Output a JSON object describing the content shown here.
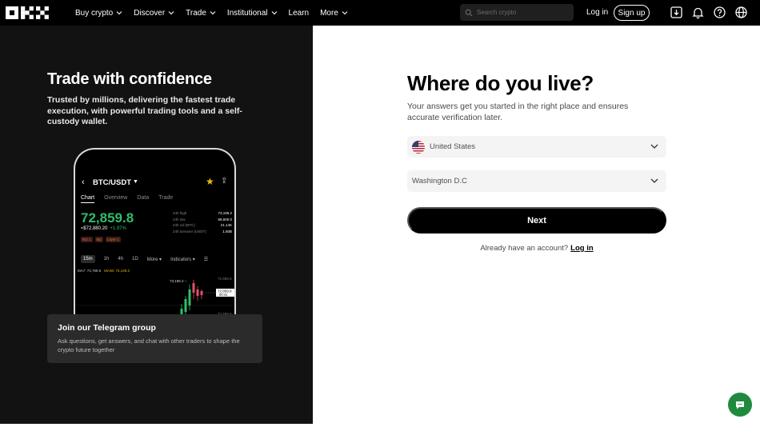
{
  "nav": {
    "logo": "OKX",
    "items": [
      {
        "label": "Buy crypto",
        "has_chevron": true
      },
      {
        "label": "Discover",
        "has_chevron": true
      },
      {
        "label": "Trade",
        "has_chevron": true
      },
      {
        "label": "Institutional",
        "has_chevron": true
      },
      {
        "label": "Learn",
        "has_chevron": false
      },
      {
        "label": "More",
        "has_chevron": true
      }
    ],
    "search_placeholder": "Search crypto",
    "login_label": "Log in",
    "signup_label": "Sign up",
    "icons": [
      "download-icon",
      "bell-icon",
      "help-icon",
      "globe-icon"
    ]
  },
  "promo": {
    "title": "Trade with confidence",
    "subtitle": "Trusted by millions, delivering the fastest trade execution, with powerful trading tools and a self-custody wallet.",
    "phone": {
      "pair": "BTC/USDT",
      "tabs": [
        "Chart",
        "Overview",
        "Data",
        "Trade"
      ],
      "active_tab": "Chart",
      "price": "72,859.8",
      "usd_price": "≈$72,880.20",
      "change": "+1.97%",
      "badges": [
        "NO.1",
        "5tp",
        "Layer 1"
      ],
      "stats": [
        {
          "label": "24h high",
          "value": "73,196.2"
        },
        {
          "label": "24h low",
          "value": "68,600.0"
        },
        {
          "label": "24h vol (BTC)",
          "value": "21.14K"
        },
        {
          "label": "24h turnover (USDT)",
          "value": "1.50B"
        }
      ],
      "timeframes": [
        "15m",
        "1h",
        "4h",
        "1D",
        "More ▾",
        "Indicators ▾"
      ],
      "selected_timeframe": "15m",
      "ma_labels": {
        "ma7": "MA7: 72,768.6",
        "ma30": "MA30: 72,149.2"
      },
      "chart_labels": {
        "high_marker": "73,196.2 –",
        "right_top": "72,988.6",
        "current": "72,859.8",
        "countdown": "00:41",
        "right_bottom": "72,496.6"
      }
    },
    "telegram": {
      "title": "Join our Telegram group",
      "description": "Ask questions, get answers, and chat with other traders to shape the crypto future together"
    }
  },
  "form": {
    "title": "Where do you live?",
    "subtitle": "Your answers get you started in the right place and ensures accurate verification later.",
    "country": "United States",
    "region": "Washington D.C",
    "next_label": "Next",
    "have_account_text": "Already have an account?",
    "login_link": "Log in"
  },
  "colors": {
    "accent_green": "#2fbd6b",
    "chat_fab": "#1f8a3e",
    "star": "#f0b90b"
  }
}
